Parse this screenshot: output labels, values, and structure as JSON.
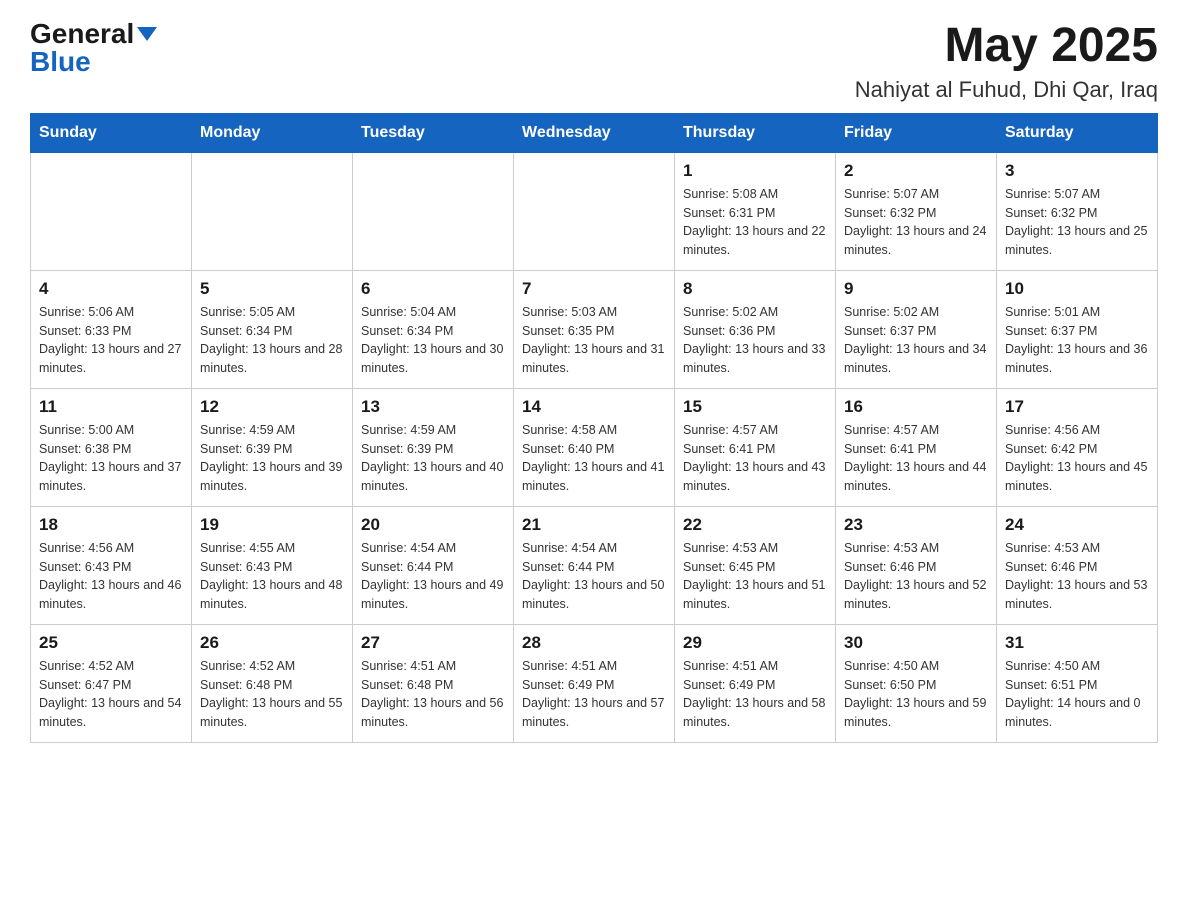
{
  "header": {
    "logo_general": "General",
    "logo_blue": "Blue",
    "month_title": "May 2025",
    "location": "Nahiyat al Fuhud, Dhi Qar, Iraq"
  },
  "weekdays": [
    "Sunday",
    "Monday",
    "Tuesday",
    "Wednesday",
    "Thursday",
    "Friday",
    "Saturday"
  ],
  "weeks": [
    [
      {
        "day": "",
        "info": ""
      },
      {
        "day": "",
        "info": ""
      },
      {
        "day": "",
        "info": ""
      },
      {
        "day": "",
        "info": ""
      },
      {
        "day": "1",
        "info": "Sunrise: 5:08 AM\nSunset: 6:31 PM\nDaylight: 13 hours and 22 minutes."
      },
      {
        "day": "2",
        "info": "Sunrise: 5:07 AM\nSunset: 6:32 PM\nDaylight: 13 hours and 24 minutes."
      },
      {
        "day": "3",
        "info": "Sunrise: 5:07 AM\nSunset: 6:32 PM\nDaylight: 13 hours and 25 minutes."
      }
    ],
    [
      {
        "day": "4",
        "info": "Sunrise: 5:06 AM\nSunset: 6:33 PM\nDaylight: 13 hours and 27 minutes."
      },
      {
        "day": "5",
        "info": "Sunrise: 5:05 AM\nSunset: 6:34 PM\nDaylight: 13 hours and 28 minutes."
      },
      {
        "day": "6",
        "info": "Sunrise: 5:04 AM\nSunset: 6:34 PM\nDaylight: 13 hours and 30 minutes."
      },
      {
        "day": "7",
        "info": "Sunrise: 5:03 AM\nSunset: 6:35 PM\nDaylight: 13 hours and 31 minutes."
      },
      {
        "day": "8",
        "info": "Sunrise: 5:02 AM\nSunset: 6:36 PM\nDaylight: 13 hours and 33 minutes."
      },
      {
        "day": "9",
        "info": "Sunrise: 5:02 AM\nSunset: 6:37 PM\nDaylight: 13 hours and 34 minutes."
      },
      {
        "day": "10",
        "info": "Sunrise: 5:01 AM\nSunset: 6:37 PM\nDaylight: 13 hours and 36 minutes."
      }
    ],
    [
      {
        "day": "11",
        "info": "Sunrise: 5:00 AM\nSunset: 6:38 PM\nDaylight: 13 hours and 37 minutes."
      },
      {
        "day": "12",
        "info": "Sunrise: 4:59 AM\nSunset: 6:39 PM\nDaylight: 13 hours and 39 minutes."
      },
      {
        "day": "13",
        "info": "Sunrise: 4:59 AM\nSunset: 6:39 PM\nDaylight: 13 hours and 40 minutes."
      },
      {
        "day": "14",
        "info": "Sunrise: 4:58 AM\nSunset: 6:40 PM\nDaylight: 13 hours and 41 minutes."
      },
      {
        "day": "15",
        "info": "Sunrise: 4:57 AM\nSunset: 6:41 PM\nDaylight: 13 hours and 43 minutes."
      },
      {
        "day": "16",
        "info": "Sunrise: 4:57 AM\nSunset: 6:41 PM\nDaylight: 13 hours and 44 minutes."
      },
      {
        "day": "17",
        "info": "Sunrise: 4:56 AM\nSunset: 6:42 PM\nDaylight: 13 hours and 45 minutes."
      }
    ],
    [
      {
        "day": "18",
        "info": "Sunrise: 4:56 AM\nSunset: 6:43 PM\nDaylight: 13 hours and 46 minutes."
      },
      {
        "day": "19",
        "info": "Sunrise: 4:55 AM\nSunset: 6:43 PM\nDaylight: 13 hours and 48 minutes."
      },
      {
        "day": "20",
        "info": "Sunrise: 4:54 AM\nSunset: 6:44 PM\nDaylight: 13 hours and 49 minutes."
      },
      {
        "day": "21",
        "info": "Sunrise: 4:54 AM\nSunset: 6:44 PM\nDaylight: 13 hours and 50 minutes."
      },
      {
        "day": "22",
        "info": "Sunrise: 4:53 AM\nSunset: 6:45 PM\nDaylight: 13 hours and 51 minutes."
      },
      {
        "day": "23",
        "info": "Sunrise: 4:53 AM\nSunset: 6:46 PM\nDaylight: 13 hours and 52 minutes."
      },
      {
        "day": "24",
        "info": "Sunrise: 4:53 AM\nSunset: 6:46 PM\nDaylight: 13 hours and 53 minutes."
      }
    ],
    [
      {
        "day": "25",
        "info": "Sunrise: 4:52 AM\nSunset: 6:47 PM\nDaylight: 13 hours and 54 minutes."
      },
      {
        "day": "26",
        "info": "Sunrise: 4:52 AM\nSunset: 6:48 PM\nDaylight: 13 hours and 55 minutes."
      },
      {
        "day": "27",
        "info": "Sunrise: 4:51 AM\nSunset: 6:48 PM\nDaylight: 13 hours and 56 minutes."
      },
      {
        "day": "28",
        "info": "Sunrise: 4:51 AM\nSunset: 6:49 PM\nDaylight: 13 hours and 57 minutes."
      },
      {
        "day": "29",
        "info": "Sunrise: 4:51 AM\nSunset: 6:49 PM\nDaylight: 13 hours and 58 minutes."
      },
      {
        "day": "30",
        "info": "Sunrise: 4:50 AM\nSunset: 6:50 PM\nDaylight: 13 hours and 59 minutes."
      },
      {
        "day": "31",
        "info": "Sunrise: 4:50 AM\nSunset: 6:51 PM\nDaylight: 14 hours and 0 minutes."
      }
    ]
  ]
}
